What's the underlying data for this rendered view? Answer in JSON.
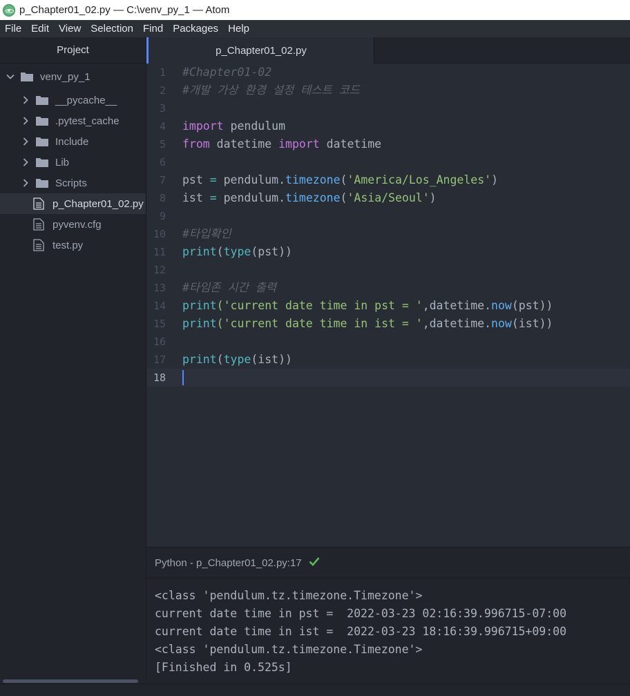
{
  "window": {
    "title": "p_Chapter01_02.py — C:\\venv_py_1 — Atom"
  },
  "menu": [
    "File",
    "Edit",
    "View",
    "Selection",
    "Find",
    "Packages",
    "Help"
  ],
  "sidebar": {
    "header": "Project",
    "root": "venv_py_1",
    "folders": [
      "__pycache__",
      ".pytest_cache",
      "Include",
      "Lib",
      "Scripts"
    ],
    "files": [
      "p_Chapter01_02.py",
      "pyvenv.cfg",
      "test.py"
    ],
    "selected": "p_Chapter01_02.py"
  },
  "tabs": [
    {
      "label": "p_Chapter01_02.py",
      "active": true
    }
  ],
  "editor": {
    "current_line": 18,
    "line_numbers": [
      "1",
      "2",
      "3",
      "4",
      "5",
      "6",
      "7",
      "8",
      "9",
      "10",
      "11",
      "12",
      "13",
      "14",
      "15",
      "16",
      "17",
      "18"
    ],
    "lines": [
      [
        {
          "t": "#Chapter01-02",
          "c": "cmt"
        }
      ],
      [
        {
          "t": "#개발 가상 환경 설정 테스트 코드",
          "c": "cmt"
        }
      ],
      [],
      [
        {
          "t": "import",
          "c": "kw"
        },
        {
          "t": " pendulum",
          "c": ""
        }
      ],
      [
        {
          "t": "from",
          "c": "kw"
        },
        {
          "t": " datetime ",
          "c": ""
        },
        {
          "t": "import",
          "c": "kw"
        },
        {
          "t": " datetime",
          "c": ""
        }
      ],
      [],
      [
        {
          "t": "pst ",
          "c": ""
        },
        {
          "t": "=",
          "c": "op"
        },
        {
          "t": " pendulum.",
          "c": ""
        },
        {
          "t": "timezone",
          "c": "fn"
        },
        {
          "t": "(",
          "c": ""
        },
        {
          "t": "'America/Los_Angeles'",
          "c": "str"
        },
        {
          "t": ")",
          "c": ""
        }
      ],
      [
        {
          "t": "ist ",
          "c": ""
        },
        {
          "t": "=",
          "c": "op"
        },
        {
          "t": " pendulum.",
          "c": ""
        },
        {
          "t": "timezone",
          "c": "fn"
        },
        {
          "t": "(",
          "c": ""
        },
        {
          "t": "'Asia/Seoul'",
          "c": "str"
        },
        {
          "t": ")",
          "c": ""
        }
      ],
      [],
      [
        {
          "t": "#타입확인",
          "c": "cmt"
        }
      ],
      [
        {
          "t": "print",
          "c": "bi"
        },
        {
          "t": "(",
          "c": ""
        },
        {
          "t": "type",
          "c": "bi"
        },
        {
          "t": "(pst))",
          "c": ""
        }
      ],
      [],
      [
        {
          "t": "#타임존 시간 출력",
          "c": "cmt"
        }
      ],
      [
        {
          "t": "print",
          "c": "bi"
        },
        {
          "t": "('current date time in pst = '",
          "c": "str"
        },
        {
          "t": ",datetime.",
          "c": ""
        },
        {
          "t": "now",
          "c": "fn"
        },
        {
          "t": "(pst))",
          "c": ""
        }
      ],
      [
        {
          "t": "print",
          "c": "bi"
        },
        {
          "t": "('current date time in ist = '",
          "c": "str"
        },
        {
          "t": ",datetime.",
          "c": ""
        },
        {
          "t": "now",
          "c": "fn"
        },
        {
          "t": "(ist))",
          "c": ""
        }
      ],
      [],
      [
        {
          "t": "print",
          "c": "bi"
        },
        {
          "t": "(",
          "c": ""
        },
        {
          "t": "type",
          "c": "bi"
        },
        {
          "t": "(ist))",
          "c": ""
        }
      ],
      []
    ]
  },
  "output": {
    "header": "Python - p_Chapter01_02.py:17",
    "lines": [
      "<class 'pendulum.tz.timezone.Timezone'>",
      "current date time in pst =  2022-03-23 02:16:39.996715-07:00",
      "current date time in ist =  2022-03-23 18:16:39.996715+09:00",
      "<class 'pendulum.tz.timezone.Timezone'>",
      "[Finished in 0.525s]"
    ]
  },
  "colors": {
    "accent": "#568af2",
    "success": "#5cb85c"
  }
}
